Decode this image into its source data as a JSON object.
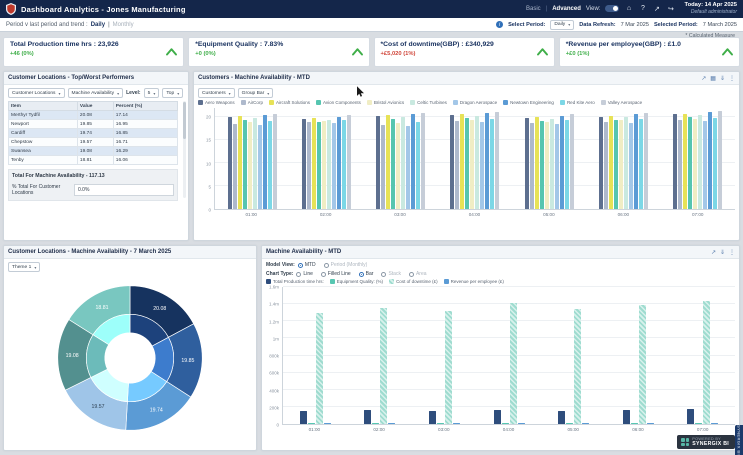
{
  "app": {
    "title": "Dashboard Analytics - Jones Manufacturing",
    "view": {
      "basic": "Basic",
      "advanced": "Advanced",
      "label": "View:"
    },
    "today": "Today: 14 Apr 2025",
    "user": "Default administrator"
  },
  "icons": {
    "home": "⌂",
    "help": "?",
    "share": "↗",
    "logout": "↪",
    "dropdown": "▾",
    "info": "i",
    "panel_share": "↗",
    "panel_layers": "▦",
    "panel_download": "⇓",
    "panel_menu": "⋮"
  },
  "toolbar": {
    "period_trend_label": "Period v last period and trend :",
    "daily": "Daily",
    "sep": "|",
    "monthly": "Monthly",
    "select_period_label": "Select Period:",
    "select_period_value": "Daily",
    "data_refresh_label": "Data Refresh:",
    "data_refresh_value": "7 Mar 2025",
    "selected_period_label": "Selected Period:",
    "selected_period_value": "7 March 2025",
    "calculated_measure": "* Calculated Measure"
  },
  "kpis": [
    {
      "title": "Total Production time hrs : 23,926",
      "delta": "+46 (0%)",
      "delta_color": "#3fae49",
      "trend": "up"
    },
    {
      "title": "*Equipment Quality : 7.83%",
      "delta": "+0 (0%)",
      "delta_color": "#3fae49",
      "trend": "up"
    },
    {
      "title": "*Cost of downtime(GBP) : £340,929",
      "delta": "+£5,020 (1%)",
      "delta_color": "#d0463a",
      "trend": "up"
    },
    {
      "title": "*Revenue per employee(GBP) : £1.0",
      "delta": "+£0 (1%)",
      "delta_color": "#3fae49",
      "trend": "up"
    }
  ],
  "performers": {
    "title": "Customer Locations - Top/Worst Performers",
    "dropdown_dimension": "Customer Locations",
    "dropdown_measure": "Machine Availability",
    "level_label": "Level:",
    "level_value": "5",
    "top_value": "Top",
    "table": {
      "columns": [
        "Item",
        "Value",
        "Percent (%)"
      ],
      "rows": [
        [
          "Merthyr Tydfil",
          "20.08",
          "17.14"
        ],
        [
          "Newport",
          "19.85",
          "16.95"
        ],
        [
          "Cardiff",
          "19.74",
          "16.85"
        ],
        [
          "Chepstow",
          "19.57",
          "16.71"
        ],
        [
          "Swansea",
          "19.08",
          "16.29"
        ],
        [
          "Tenby",
          "18.81",
          "16.06"
        ]
      ]
    },
    "total_label": "Total For Machine Availability - 117.13",
    "pct_label": "% Total For Customer Locations",
    "pct_value": "0.0%"
  },
  "customers_chart": {
    "title": "Customers - Machine Availability - MTD",
    "dropdown_dimension": "Customers",
    "dropdown_type": "Group Bar",
    "chart_data": {
      "type": "bar",
      "x": [
        "01:00",
        "02:00",
        "03:00",
        "04:00",
        "05:00",
        "06:00",
        "07:00"
      ],
      "ylim": [
        0,
        22
      ],
      "yticks": [
        {
          "value": 0,
          "label": "0"
        },
        {
          "value": 5,
          "label": "5"
        },
        {
          "value": 10,
          "label": "10"
        },
        {
          "value": 15,
          "label": "15"
        },
        {
          "value": 20,
          "label": "20"
        }
      ],
      "legend_position": "top",
      "grid": true,
      "series": [
        {
          "name": "Aero Weapons",
          "color": "#5d6f8f",
          "values": [
            19.8,
            19.5,
            20.0,
            20.2,
            19.7,
            19.9,
            20.4
          ]
        },
        {
          "name": "AirCorp",
          "color": "#aeb9cc",
          "values": [
            18.4,
            18.7,
            18.2,
            18.9,
            18.5,
            18.8,
            19.1
          ]
        },
        {
          "name": "Aircraft Solutions",
          "color": "#e7e257",
          "values": [
            20.0,
            19.6,
            20.2,
            20.5,
            19.9,
            20.1,
            20.6
          ]
        },
        {
          "name": "Avion Components",
          "color": "#56c5b0",
          "values": [
            19.1,
            18.8,
            19.4,
            19.6,
            19.0,
            19.3,
            19.8
          ]
        },
        {
          "name": "Bristol Avionics",
          "color": "#f0edc4",
          "values": [
            18.7,
            19.0,
            18.5,
            19.2,
            18.8,
            19.1,
            19.5
          ]
        },
        {
          "name": "Celtic Turbines",
          "color": "#c9e9e0",
          "values": [
            19.6,
            19.3,
            19.9,
            20.1,
            19.5,
            19.8,
            20.3
          ]
        },
        {
          "name": "Dragon Aerospace",
          "color": "#a3c7e8",
          "values": [
            18.1,
            18.5,
            18.0,
            18.7,
            18.3,
            18.6,
            18.9
          ]
        },
        {
          "name": "Newtown Engineering",
          "color": "#5b9bd5",
          "values": [
            20.3,
            19.9,
            20.5,
            20.8,
            20.1,
            20.4,
            20.9
          ]
        },
        {
          "name": "Red Kite Aero",
          "color": "#7cd7e6",
          "values": [
            19.0,
            19.3,
            18.8,
            19.5,
            19.1,
            19.4,
            19.7
          ]
        },
        {
          "name": "Valley Aerospace",
          "color": "#c6cdd8",
          "values": [
            20.6,
            20.2,
            20.8,
            21.0,
            20.4,
            20.7,
            21.2
          ]
        }
      ]
    }
  },
  "donut_chart": {
    "title": "Customer Locations - Machine Availability - 7 March 2025",
    "theme": "Theme 1",
    "chart_data": {
      "type": "pie",
      "labels": [
        "Merthyr Tydfil",
        "Newport",
        "Cardiff",
        "Chepstow",
        "Swansea",
        "Tenby"
      ],
      "values": [
        20.08,
        19.85,
        19.74,
        19.57,
        19.08,
        18.81
      ],
      "colors": [
        "#16335f",
        "#2f5f9e",
        "#5b9bd5",
        "#9fc5e8",
        "#53908f",
        "#79c7c0"
      ],
      "total": 117.13
    }
  },
  "ma_chart": {
    "title": "Machine Availability - MTD",
    "model_view_label": "Model View:",
    "model_options": [
      {
        "label": "MTD",
        "selected": true
      },
      {
        "label": "Period (Monthly)",
        "selected": false,
        "disabled": true
      }
    ],
    "chart_type_label": "Chart Type:",
    "chart_type_options": [
      {
        "label": "Line",
        "selected": false
      },
      {
        "label": "Filled Line",
        "selected": false
      },
      {
        "label": "Bar",
        "selected": true
      },
      {
        "label": "Stack",
        "selected": false,
        "disabled": true
      },
      {
        "label": "Area",
        "selected": false,
        "disabled": true
      }
    ],
    "chart_data": {
      "type": "bar",
      "x": [
        "01:00",
        "02:00",
        "03:00",
        "04:00",
        "05:00",
        "06:00",
        "07:00"
      ],
      "ylim": [
        0,
        1600000
      ],
      "yticks": [
        {
          "value": 0,
          "label": "0"
        },
        {
          "value": 200000,
          "label": "200k"
        },
        {
          "value": 400000,
          "label": "400k"
        },
        {
          "value": 600000,
          "label": "600k"
        },
        {
          "value": 800000,
          "label": "800k"
        },
        {
          "value": 1000000,
          "label": "1m"
        },
        {
          "value": 1200000,
          "label": "1.2m"
        },
        {
          "value": 1400000,
          "label": "1.4m"
        },
        {
          "value": 1600000,
          "label": "1.6m"
        }
      ],
      "legend_position": "top",
      "grid": true,
      "series": [
        {
          "name": "Total Production time hrs:",
          "color": "#2e4d7c",
          "values": [
            152000,
            159000,
            154000,
            164000,
            157000,
            161000,
            169000
          ]
        },
        {
          "name": "Equipment Quality: (%)",
          "color": "#57c7b2",
          "values": [
            8,
            8,
            8,
            8,
            8,
            8,
            8
          ]
        },
        {
          "name": "Cost of downtime (£)",
          "color": "#9fdcd0",
          "hatch": true,
          "values": [
            1290000,
            1345000,
            1305000,
            1400000,
            1335000,
            1380000,
            1430000
          ]
        },
        {
          "name": "Revenue per employee (£)",
          "color": "#5b9bd5",
          "values": [
            1,
            1,
            1,
            1,
            1,
            1,
            1
          ]
        }
      ]
    }
  },
  "branding": {
    "powered_by": "POWERED BY",
    "brand": "SYNERGIX BI",
    "side_tab": "SYNERGIX BI"
  }
}
